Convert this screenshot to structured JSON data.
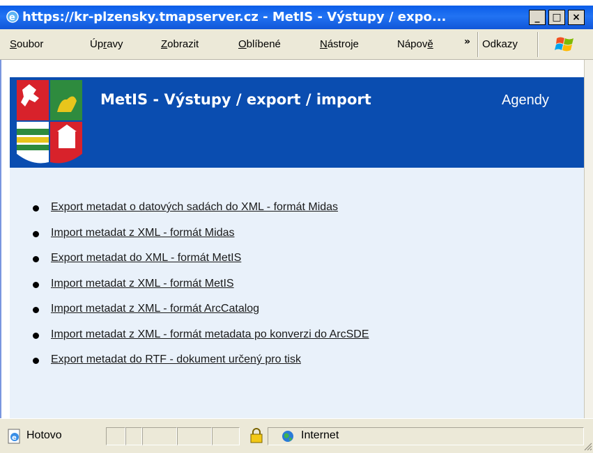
{
  "window": {
    "title": "https://kr-plzensky.tmapserver.cz - MetIS - Výstupy / expo...",
    "controls": {
      "minimize": "_",
      "maximize": "□",
      "close": "×"
    }
  },
  "menu": {
    "items": [
      {
        "pre": "",
        "accel": "S",
        "post": "oubor"
      },
      {
        "pre": "Úp",
        "accel": "r",
        "post": "avy"
      },
      {
        "pre": "",
        "accel": "Z",
        "post": "obrazit"
      },
      {
        "pre": "",
        "accel": "O",
        "post": "blíbené"
      },
      {
        "pre": "",
        "accel": "N",
        "post": "ástroje"
      },
      {
        "pre": "Nápov",
        "accel": "ě",
        "post": ""
      }
    ],
    "overflow": "»",
    "links_label": "Odkazy"
  },
  "header": {
    "title": "MetIS - Výstupy / export / import",
    "agendy": "Agendy"
  },
  "links": [
    "Export metadat o datových sadách do XML - formát Midas",
    "Import metadat z XML - formát Midas",
    "Export metadat do XML - formát MetIS",
    "Import metadat z XML - formát MetIS",
    "Import metadat z XML - formát ArcCatalog",
    "Import metadat z XML - formát metadata po konverzi do ArcSDE",
    "Export metadat do RTF - dokument určený pro tisk"
  ],
  "status": {
    "text": "Hotovo",
    "zone": "Internet"
  },
  "colors": {
    "titlebar": "#0a5ce8",
    "header_bg": "#0a4db0",
    "content_bg": "#e9f1fa",
    "chrome": "#ece9d8"
  }
}
